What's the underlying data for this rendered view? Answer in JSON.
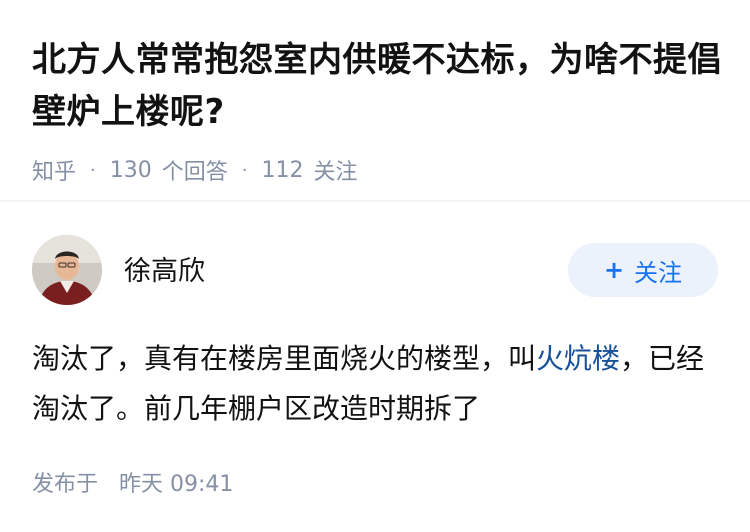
{
  "question": {
    "title": "北方人常常抱怨室内供暖不达标，为啥不提倡壁炉上楼呢?",
    "source": "知乎",
    "answers_count": "130",
    "answers_label": "个回答",
    "followers_count": "112",
    "followers_label": "关注"
  },
  "author": {
    "name": "徐高欣",
    "follow_label": "关注"
  },
  "answer": {
    "text_before": "淘汰了，真有在楼房里面烧火的楼型，叫",
    "link_text": "火炕楼",
    "text_after": "，已经淘汰了。前几年棚户区改造时期拆了"
  },
  "publish": {
    "label": "发布于",
    "time": "昨天 09:41"
  },
  "colors": {
    "accent": "#1772f6",
    "link": "#175199",
    "meta": "#8590a6",
    "follow_bg": "#ebf2fb"
  }
}
